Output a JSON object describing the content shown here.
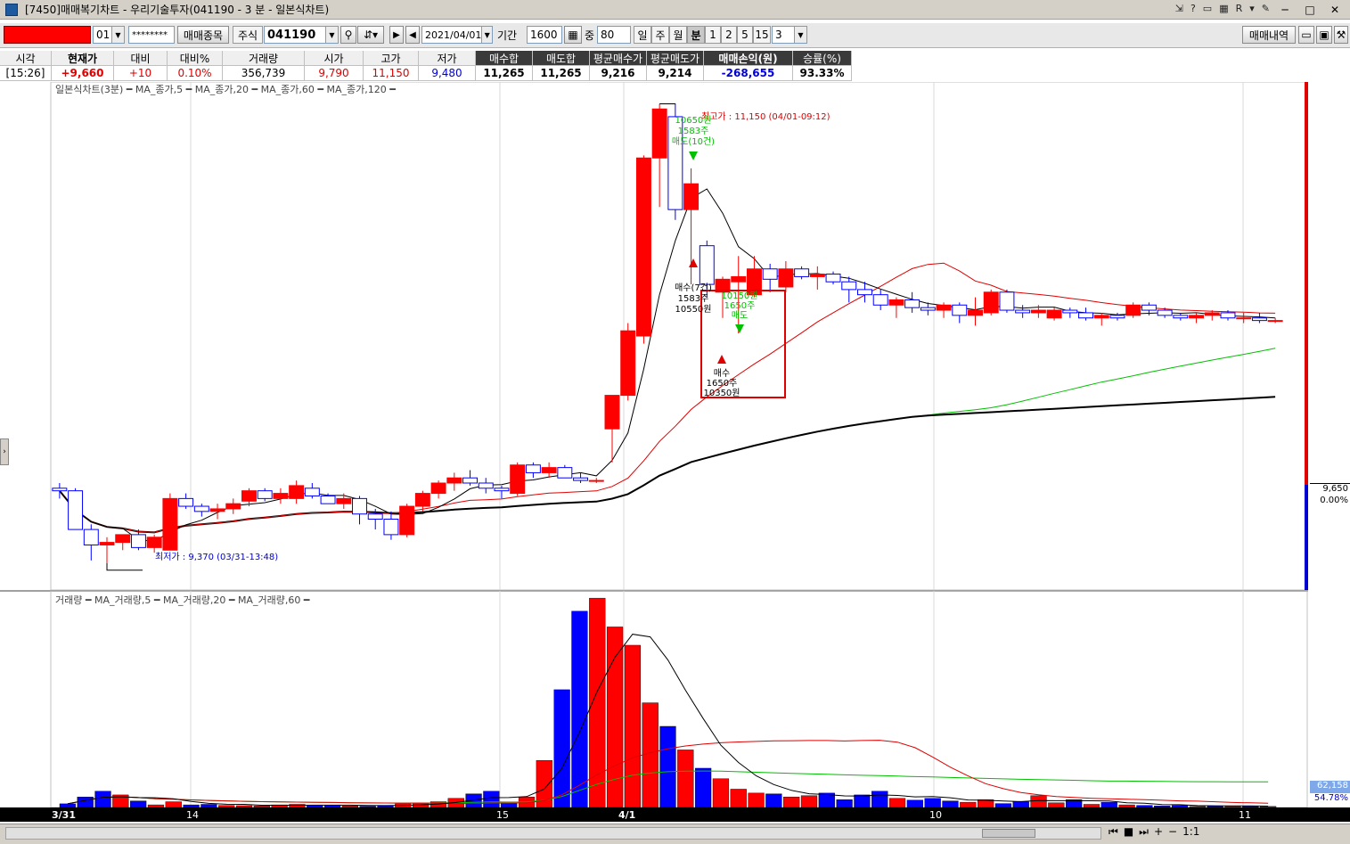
{
  "window": {
    "title": "[7450]매매복기차트 - 우리기술투자(041190 - 3 분 - 일본식차트)",
    "tools": [
      "?",
      "R"
    ]
  },
  "toolbar": {
    "account_suffix": "01",
    "password_mask": "********",
    "btn_stock": "매매종목",
    "market": "주식",
    "code": "041190",
    "date": "2021/04/01",
    "period_label": "기간",
    "period_value": "1600",
    "overlap_label": "중",
    "overlap_value": "80",
    "periods": [
      "일",
      "주",
      "월",
      "분",
      "1",
      "2",
      "5",
      "15"
    ],
    "active_period": "분",
    "interval_value": "3",
    "btn_trade_history": "매매내역"
  },
  "quote": {
    "headers": [
      "시각",
      "현재가",
      "대비",
      "대비%",
      "거래량",
      "시가",
      "고가",
      "저가",
      "매수합",
      "매도합",
      "평균매수가",
      "평균매도가",
      "매매손익(원)",
      "승률(%)"
    ],
    "values": [
      "[15:26]",
      "+9,660",
      "+10",
      "0.10%",
      "356,739",
      "9,790",
      "11,150",
      "9,480",
      "11,265",
      "11,265",
      "9,216",
      "9,214",
      "-268,655",
      "93.33%"
    ]
  },
  "chart": {
    "price_legend": "일본식차트(3분) ━ MA_종가,5 ━ MA_종가,20 ━ MA_종가,60 ━ MA_종가,120 ━",
    "volume_legend": "거래량 ━ MA_거래량,5 ━ MA_거래량,20 ━ MA_거래량,60 ━",
    "high_label": "최고가 : 11,150 (04/01-09:12)",
    "low_label": "최저가 : 9,370 (03/31-13:48)",
    "current_price_tag": "9,650",
    "current_pct_tag": "0.00%",
    "volume_tag": "62,158",
    "volume_pct_tag": "54.78%",
    "x_labels": [
      "3/31",
      "14",
      "15",
      "4/1",
      "10",
      "11"
    ],
    "annotations": {
      "sell1": [
        "10650원",
        "1583주",
        "매도(10건)"
      ],
      "buy1": [
        "매수(7건)",
        "1583주",
        "10550원"
      ],
      "sell2": [
        "10150원",
        "1650주",
        "매도"
      ],
      "buy2": [
        "매수",
        "1650주",
        "10350원"
      ]
    },
    "colors": {
      "up": "#ff0000",
      "down": "#0000ff",
      "ma5": "#000000",
      "ma20": "#e00000",
      "ma60": "#00c000",
      "ma120": "#000000"
    }
  },
  "chart_data": {
    "type": "candlestick",
    "title": "일본식차트(3분)",
    "y_range": [
      9300,
      11200
    ],
    "candles": [
      {
        "o": 9660,
        "h": 9680,
        "l": 9620,
        "c": 9650
      },
      {
        "o": 9650,
        "h": 9660,
        "l": 9500,
        "c": 9500
      },
      {
        "o": 9500,
        "h": 9520,
        "l": 9380,
        "c": 9440
      },
      {
        "o": 9440,
        "h": 9470,
        "l": 9370,
        "c": 9450
      },
      {
        "o": 9450,
        "h": 9480,
        "l": 9420,
        "c": 9480
      },
      {
        "o": 9480,
        "h": 9500,
        "l": 9420,
        "c": 9430
      },
      {
        "o": 9430,
        "h": 9480,
        "l": 9410,
        "c": 9470
      },
      {
        "o": 9420,
        "h": 9640,
        "l": 9420,
        "c": 9620
      },
      {
        "o": 9620,
        "h": 9640,
        "l": 9580,
        "c": 9590
      },
      {
        "o": 9590,
        "h": 9600,
        "l": 9550,
        "c": 9570
      },
      {
        "o": 9570,
        "h": 9600,
        "l": 9540,
        "c": 9580
      },
      {
        "o": 9580,
        "h": 9620,
        "l": 9560,
        "c": 9600
      },
      {
        "o": 9610,
        "h": 9660,
        "l": 9590,
        "c": 9650
      },
      {
        "o": 9650,
        "h": 9660,
        "l": 9610,
        "c": 9620
      },
      {
        "o": 9620,
        "h": 9660,
        "l": 9600,
        "c": 9640
      },
      {
        "o": 9620,
        "h": 9690,
        "l": 9600,
        "c": 9670
      },
      {
        "o": 9660,
        "h": 9680,
        "l": 9620,
        "c": 9630
      },
      {
        "o": 9630,
        "h": 9640,
        "l": 9600,
        "c": 9600
      },
      {
        "o": 9600,
        "h": 9640,
        "l": 9580,
        "c": 9620
      },
      {
        "o": 9620,
        "h": 9630,
        "l": 9520,
        "c": 9560
      },
      {
        "o": 9560,
        "h": 9580,
        "l": 9500,
        "c": 9540
      },
      {
        "o": 9540,
        "h": 9570,
        "l": 9460,
        "c": 9480
      },
      {
        "o": 9480,
        "h": 9600,
        "l": 9470,
        "c": 9590
      },
      {
        "o": 9590,
        "h": 9650,
        "l": 9570,
        "c": 9640
      },
      {
        "o": 9640,
        "h": 9690,
        "l": 9620,
        "c": 9680
      },
      {
        "o": 9680,
        "h": 9720,
        "l": 9650,
        "c": 9700
      },
      {
        "o": 9700,
        "h": 9730,
        "l": 9670,
        "c": 9680
      },
      {
        "o": 9680,
        "h": 9700,
        "l": 9640,
        "c": 9660
      },
      {
        "o": 9660,
        "h": 9670,
        "l": 9620,
        "c": 9650
      },
      {
        "o": 9640,
        "h": 9760,
        "l": 9630,
        "c": 9750
      },
      {
        "o": 9750,
        "h": 9760,
        "l": 9700,
        "c": 9720
      },
      {
        "o": 9720,
        "h": 9760,
        "l": 9700,
        "c": 9740
      },
      {
        "o": 9740,
        "h": 9750,
        "l": 9700,
        "c": 9700
      },
      {
        "o": 9700,
        "h": 9720,
        "l": 9680,
        "c": 9690
      },
      {
        "o": 9690,
        "h": 9700,
        "l": 9680,
        "c": 9690
      },
      {
        "o": 9890,
        "h": 10000,
        "l": 9760,
        "c": 10020
      },
      {
        "o": 10020,
        "h": 10300,
        "l": 10000,
        "c": 10270
      },
      {
        "o": 10250,
        "h": 10950,
        "l": 10220,
        "c": 10940
      },
      {
        "o": 10940,
        "h": 11150,
        "l": 10750,
        "c": 11130
      },
      {
        "o": 11100,
        "h": 11150,
        "l": 10700,
        "c": 10740
      },
      {
        "o": 10740,
        "h": 10900,
        "l": 10450,
        "c": 10840
      },
      {
        "o": 10600,
        "h": 10620,
        "l": 10400,
        "c": 10450
      },
      {
        "o": 10420,
        "h": 10480,
        "l": 10320,
        "c": 10470
      },
      {
        "o": 10460,
        "h": 10560,
        "l": 10260,
        "c": 10480
      },
      {
        "o": 10410,
        "h": 10560,
        "l": 10400,
        "c": 10510
      },
      {
        "o": 10510,
        "h": 10530,
        "l": 10420,
        "c": 10470
      },
      {
        "o": 10440,
        "h": 10540,
        "l": 10420,
        "c": 10510
      },
      {
        "o": 10510,
        "h": 10520,
        "l": 10470,
        "c": 10480
      },
      {
        "o": 10480,
        "h": 10520,
        "l": 10430,
        "c": 10490
      },
      {
        "o": 10490,
        "h": 10500,
        "l": 10450,
        "c": 10460
      },
      {
        "o": 10460,
        "h": 10480,
        "l": 10380,
        "c": 10430
      },
      {
        "o": 10430,
        "h": 10460,
        "l": 10380,
        "c": 10410
      },
      {
        "o": 10410,
        "h": 10430,
        "l": 10350,
        "c": 10370
      },
      {
        "o": 10370,
        "h": 10400,
        "l": 10320,
        "c": 10390
      },
      {
        "o": 10390,
        "h": 10420,
        "l": 10340,
        "c": 10360
      },
      {
        "o": 10360,
        "h": 10380,
        "l": 10330,
        "c": 10350
      },
      {
        "o": 10350,
        "h": 10380,
        "l": 10320,
        "c": 10370
      },
      {
        "o": 10370,
        "h": 10380,
        "l": 10300,
        "c": 10330
      },
      {
        "o": 10330,
        "h": 10400,
        "l": 10290,
        "c": 10350
      },
      {
        "o": 10340,
        "h": 10430,
        "l": 10330,
        "c": 10420
      },
      {
        "o": 10420,
        "h": 10430,
        "l": 10340,
        "c": 10350
      },
      {
        "o": 10350,
        "h": 10370,
        "l": 10320,
        "c": 10340
      },
      {
        "o": 10340,
        "h": 10370,
        "l": 10320,
        "c": 10350
      },
      {
        "o": 10320,
        "h": 10360,
        "l": 10310,
        "c": 10350
      },
      {
        "o": 10350,
        "h": 10360,
        "l": 10320,
        "c": 10340
      },
      {
        "o": 10340,
        "h": 10360,
        "l": 10310,
        "c": 10320
      },
      {
        "o": 10320,
        "h": 10340,
        "l": 10290,
        "c": 10330
      },
      {
        "o": 10330,
        "h": 10340,
        "l": 10310,
        "c": 10320
      },
      {
        "o": 10330,
        "h": 10380,
        "l": 10320,
        "c": 10370
      },
      {
        "o": 10370,
        "h": 10380,
        "l": 10330,
        "c": 10350
      },
      {
        "o": 10350,
        "h": 10360,
        "l": 10320,
        "c": 10330
      },
      {
        "o": 10330,
        "h": 10340,
        "l": 10310,
        "c": 10320
      },
      {
        "o": 10320,
        "h": 10340,
        "l": 10300,
        "c": 10330
      },
      {
        "o": 10330,
        "h": 10350,
        "l": 10310,
        "c": 10340
      },
      {
        "o": 10340,
        "h": 10350,
        "l": 10310,
        "c": 10320
      },
      {
        "o": 10320,
        "h": 10340,
        "l": 10300,
        "c": 10320
      },
      {
        "o": 10320,
        "h": 10340,
        "l": 10300,
        "c": 10310
      },
      {
        "o": 10310,
        "h": 10320,
        "l": 10300,
        "c": 10310
      }
    ],
    "volume": [
      14,
      40,
      62,
      48,
      25,
      10,
      22,
      10,
      12,
      8,
      7,
      6,
      10,
      12,
      9,
      8,
      6,
      5,
      8,
      14,
      17,
      22,
      35,
      52,
      62,
      18,
      40,
      180,
      450,
      750,
      800,
      690,
      620,
      400,
      310,
      220,
      150,
      110,
      70,
      55,
      52,
      40,
      45,
      55,
      30,
      48,
      62,
      35,
      28,
      35,
      25,
      20,
      30,
      15,
      22,
      45,
      18,
      30,
      12,
      20,
      10,
      8,
      6,
      8,
      4,
      6,
      5,
      6,
      4
    ],
    "volume_y_range": [
      0,
      780
    ]
  }
}
